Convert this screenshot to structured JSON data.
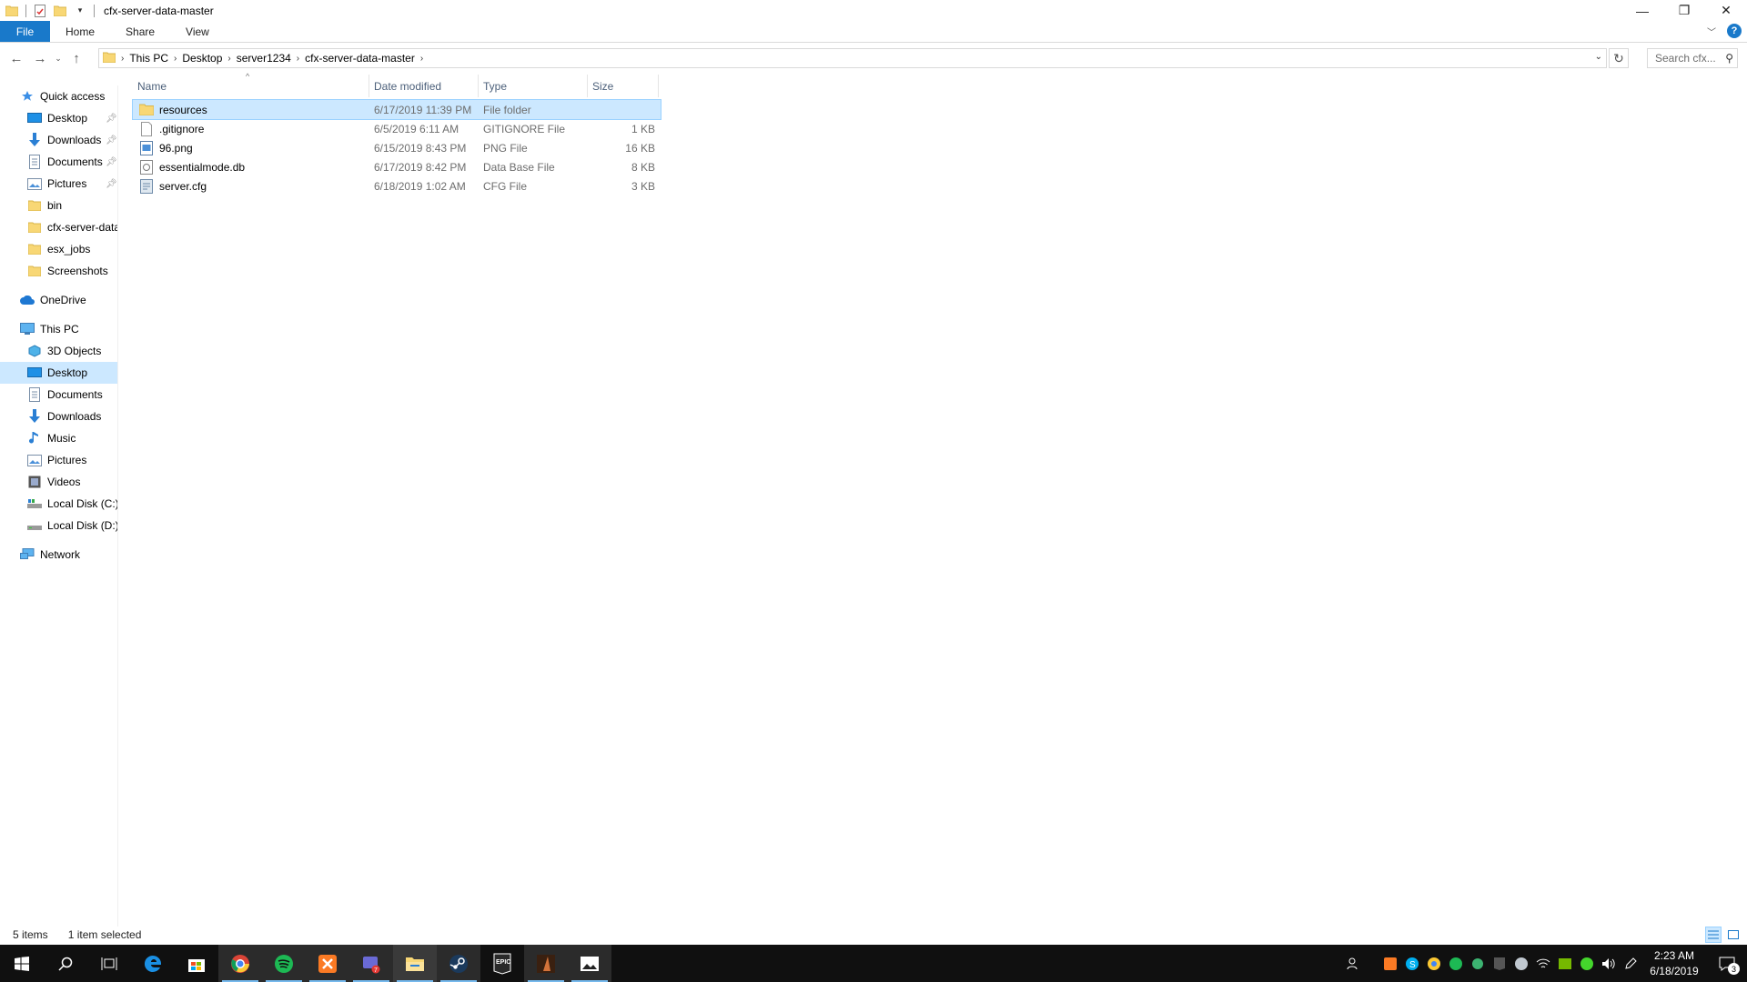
{
  "window": {
    "title": "cfx-server-data-master",
    "controls": {
      "minimize": "—",
      "maximize": "❐",
      "close": "✕"
    }
  },
  "ribbon": {
    "tabs": [
      "File",
      "Home",
      "Share",
      "View"
    ],
    "help": "?"
  },
  "address": {
    "crumbs": [
      "This PC",
      "Desktop",
      "server1234",
      "cfx-server-data-master"
    ],
    "search_placeholder": "Search cfx..."
  },
  "nav": {
    "quick_access": "Quick access",
    "quick_items": [
      "Desktop",
      "Downloads",
      "Documents",
      "Pictures",
      "bin",
      "cfx-server-data",
      "esx_jobs",
      "Screenshots"
    ],
    "onedrive": "OneDrive",
    "this_pc": "This PC",
    "pc_items": [
      "3D Objects",
      "Desktop",
      "Documents",
      "Downloads",
      "Music",
      "Pictures",
      "Videos",
      "Local Disk (C:)",
      "Local Disk (D:)"
    ],
    "network": "Network",
    "selected": "Desktop"
  },
  "list": {
    "columns": [
      "Name",
      "Date modified",
      "Type",
      "Size"
    ],
    "rows": [
      {
        "name": "resources",
        "date": "6/17/2019 11:39 PM",
        "type": "File folder",
        "size": "",
        "icon": "folder-icon"
      },
      {
        "name": ".gitignore",
        "date": "6/5/2019 6:11 AM",
        "type": "GITIGNORE File",
        "size": "1 KB",
        "icon": "text-file-icon"
      },
      {
        "name": "96.png",
        "date": "6/15/2019 8:43 PM",
        "type": "PNG File",
        "size": "16 KB",
        "icon": "image-file-icon"
      },
      {
        "name": "essentialmode.db",
        "date": "6/17/2019 8:42 PM",
        "type": "Data Base File",
        "size": "8 KB",
        "icon": "db-file-icon"
      },
      {
        "name": "server.cfg",
        "date": "6/18/2019 1:02 AM",
        "type": "CFG File",
        "size": "3 KB",
        "icon": "config-file-icon"
      }
    ]
  },
  "status": {
    "items": "5 items",
    "selected": "1 item selected"
  },
  "taskbar": {
    "time": "2:23 AM",
    "date": "6/18/2019",
    "notifications": "3",
    "epic_label": "EPIC"
  },
  "colors": {
    "accent": "#1979ca",
    "selection": "#cce8ff",
    "folder": "#f8d775"
  }
}
